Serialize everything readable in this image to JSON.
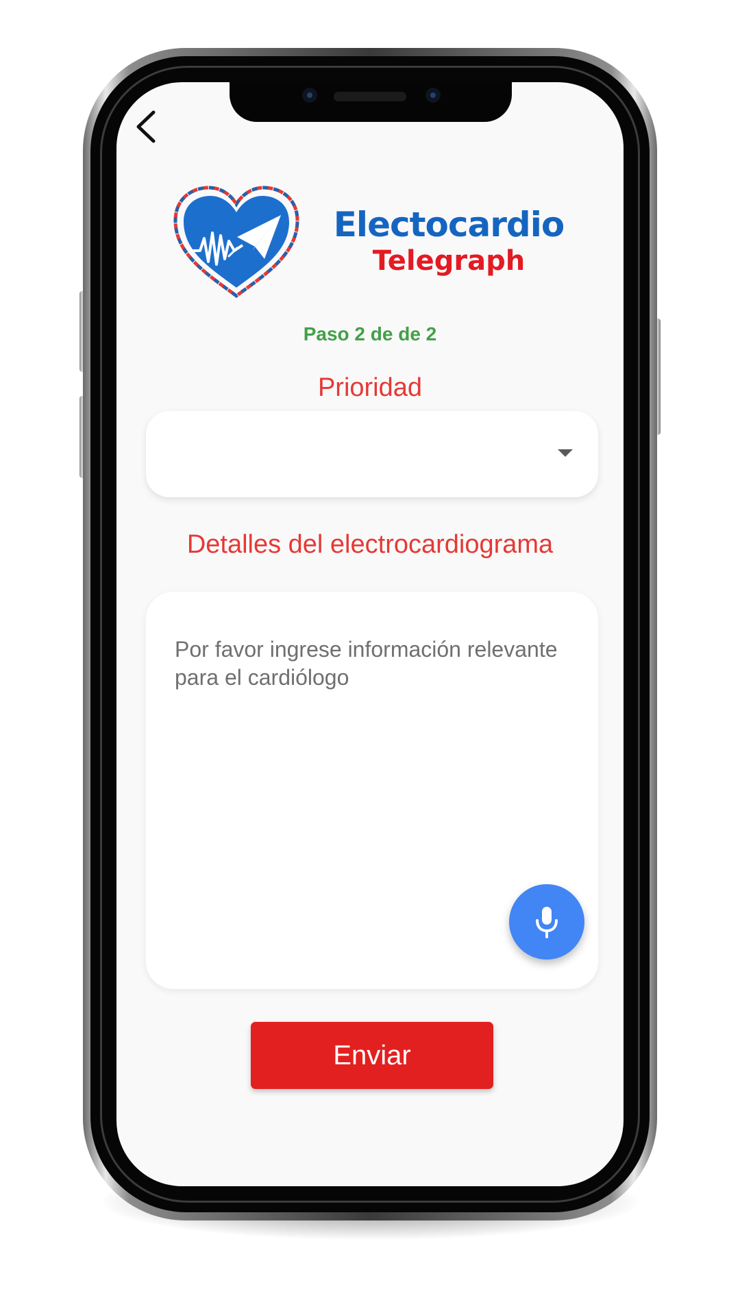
{
  "brand": {
    "title": "Electocardio",
    "subtitle": "Telegraph",
    "title_color": "#1565c0",
    "subtitle_color": "#e31b23"
  },
  "step": {
    "text": "Paso 2 de de 2",
    "color": "#43a047"
  },
  "priority": {
    "label": "Prioridad",
    "label_color": "#e53935",
    "selected_value": ""
  },
  "details": {
    "label": "Detalles del electrocardiograma",
    "label_color": "#e53935",
    "value": "",
    "placeholder": "Por favor ingrese información relevante para el cardiólogo"
  },
  "mic_button": {
    "icon": "microphone-icon",
    "color": "#4285f4"
  },
  "send_button": {
    "label": "Enviar",
    "color": "#e32020"
  },
  "back_button": {
    "icon": "chevron-left-icon"
  }
}
